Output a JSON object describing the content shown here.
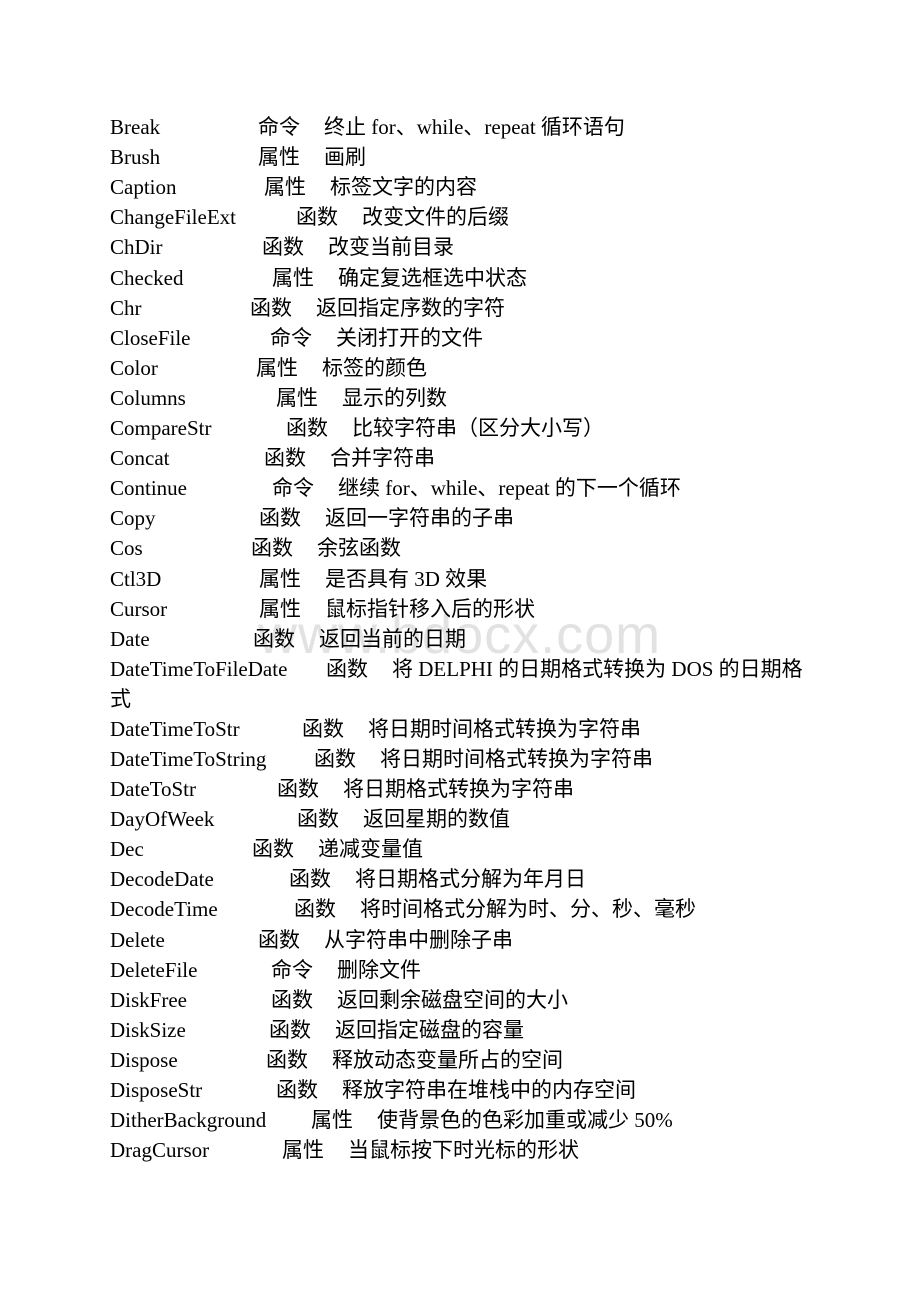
{
  "document": {
    "watermark": "www.bdocx.com",
    "entries": [
      {
        "name": "Break",
        "kind": "命令",
        "desc": "终止 for、while、repeat 循环语句"
      },
      {
        "name": "Brush",
        "kind": "属性",
        "desc": "画刷"
      },
      {
        "name": "Caption",
        "kind": "属性",
        "desc": "标签文字的内容"
      },
      {
        "name": "ChangeFileExt",
        "kind": "函数",
        "desc": "改变文件的后缀"
      },
      {
        "name": "ChDir",
        "kind": "函数",
        "desc": "改变当前目录"
      },
      {
        "name": "Checked",
        "kind": "属性",
        "desc": "确定复选框选中状态"
      },
      {
        "name": "Chr",
        "kind": "函数",
        "desc": "返回指定序数的字符"
      },
      {
        "name": "CloseFile",
        "kind": "命令",
        "desc": "关闭打开的文件"
      },
      {
        "name": "Color",
        "kind": "属性",
        "desc": "标签的颜色"
      },
      {
        "name": "Columns",
        "kind": "属性",
        "desc": "显示的列数"
      },
      {
        "name": "CompareStr",
        "kind": "函数",
        "desc": "比较字符串（区分大小写）"
      },
      {
        "name": "Concat",
        "kind": "函数",
        "desc": "合并字符串"
      },
      {
        "name": "Continue",
        "kind": "命令",
        "desc": "继续 for、while、repeat 的下一个循环"
      },
      {
        "name": "Copy",
        "kind": "函数",
        "desc": "返回一字符串的子串"
      },
      {
        "name": "Cos",
        "kind": "函数",
        "desc": "余弦函数"
      },
      {
        "name": "Ctl3D",
        "kind": "属性",
        "desc": "是否具有 3D 效果"
      },
      {
        "name": "Cursor",
        "kind": "属性",
        "desc": "鼠标指针移入后的形状"
      },
      {
        "name": "Date",
        "kind": "函数",
        "desc": "返回当前的日期"
      },
      {
        "name": "DateTimeToFileDate",
        "kind": "函数",
        "desc": "将 DELPHI 的日期格式转换为 DOS 的日期格式"
      },
      {
        "name": "DateTimeToStr",
        "kind": "函数",
        "desc": "将日期时间格式转换为字符串"
      },
      {
        "name": "DateTimeToString",
        "kind": "函数",
        "desc": "将日期时间格式转换为字符串"
      },
      {
        "name": "DateToStr",
        "kind": "函数",
        "desc": "将日期格式转换为字符串"
      },
      {
        "name": "DayOfWeek",
        "kind": "函数",
        "desc": "返回星期的数值"
      },
      {
        "name": "Dec",
        "kind": "函数",
        "desc": "递减变量值"
      },
      {
        "name": "DecodeDate",
        "kind": "函数",
        "desc": "将日期格式分解为年月日"
      },
      {
        "name": "DecodeTime",
        "kind": "函数",
        "desc": "将时间格式分解为时、分、秒、毫秒"
      },
      {
        "name": "Delete",
        "kind": "函数",
        "desc": "从字符串中删除子串"
      },
      {
        "name": "DeleteFile",
        "kind": "命令",
        "desc": "删除文件"
      },
      {
        "name": "DiskFree",
        "kind": "函数",
        "desc": "返回剩余磁盘空间的大小"
      },
      {
        "name": "DiskSize",
        "kind": "函数",
        "desc": "返回指定磁盘的容量"
      },
      {
        "name": "Dispose",
        "kind": "函数",
        "desc": "释放动态变量所占的空间"
      },
      {
        "name": "DisposeStr",
        "kind": "函数",
        "desc": "释放字符串在堆栈中的内存空间"
      },
      {
        "name": "DitherBackground",
        "kind": "属性",
        "desc": "使背景色的色彩加重或减少 50%"
      },
      {
        "name": "DragCursor",
        "kind": "属性",
        "desc": "当鼠标按下时光标的形状"
      }
    ]
  }
}
